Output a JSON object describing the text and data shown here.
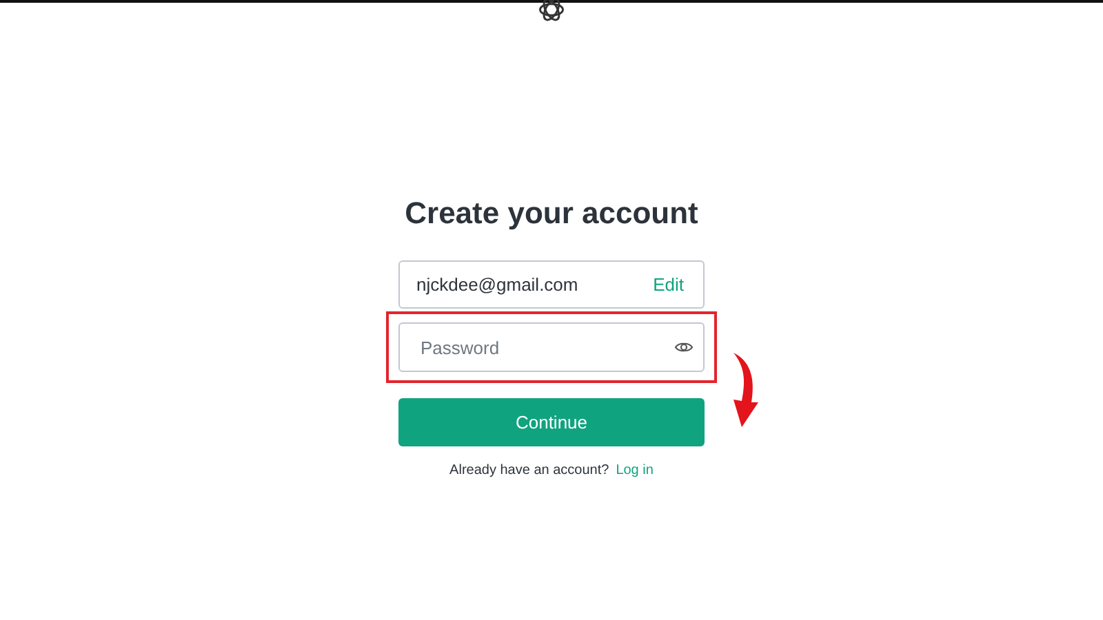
{
  "title": "Create your account",
  "email_field": {
    "value": "njckdee@gmail.com",
    "action": "Edit"
  },
  "password_field": {
    "placeholder": "Password"
  },
  "continue_button": {
    "label": "Continue"
  },
  "footer": {
    "text": "Already have an account?",
    "link": "Log in"
  }
}
